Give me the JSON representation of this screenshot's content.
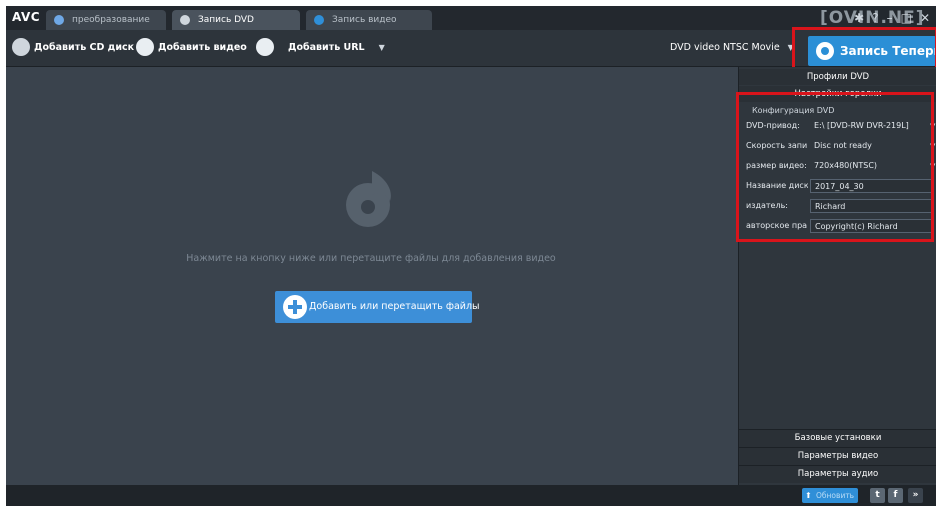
{
  "app": {
    "logo": "AVC",
    "watermark": "[OVIN.NE]"
  },
  "tabs": [
    {
      "label": "преобразование",
      "active": false
    },
    {
      "label": "Запись DVD",
      "active": true
    },
    {
      "label": "Запись видео",
      "active": false
    }
  ],
  "toolbar": {
    "add_cd": "Добавить CD диск",
    "add_video": "Добавить видео",
    "add_url": "Добавить URL",
    "profile": "DVD video NTSC Movie",
    "burn_now": "Запись Теперь!"
  },
  "main": {
    "hint": "Нажмите на кнопку ниже или перетащите файлы для добавления видео",
    "add_files": "Добавить или перетащить файлы"
  },
  "panel": {
    "profiles": "Профили DVD",
    "burner_settings": "Настройки горелки",
    "group_title": "Конфигурация DVD",
    "rows": [
      {
        "label": "DVD-привод:",
        "value": "E:\\ [DVD-RW  DVR-219L]"
      },
      {
        "label": "Скорость запи",
        "value": "Disc not ready"
      },
      {
        "label": "размер видео:",
        "value": "720x480(NTSC)"
      },
      {
        "label": "Название диск",
        "value": "2017_04_30"
      },
      {
        "label": "издатель:",
        "value": "Richard"
      },
      {
        "label": "авторское пра",
        "value": "Copyright(c) Richard"
      }
    ],
    "basic_settings": "Базовые установки",
    "video_params": "Параметры видео",
    "audio_params": "Параметры аудио"
  },
  "statusbar": {
    "update": "Обновить",
    "more": "»"
  },
  "colors": {
    "accent": "#2b8fd6",
    "highlight": "#d9141b",
    "background": "#3a434d"
  }
}
